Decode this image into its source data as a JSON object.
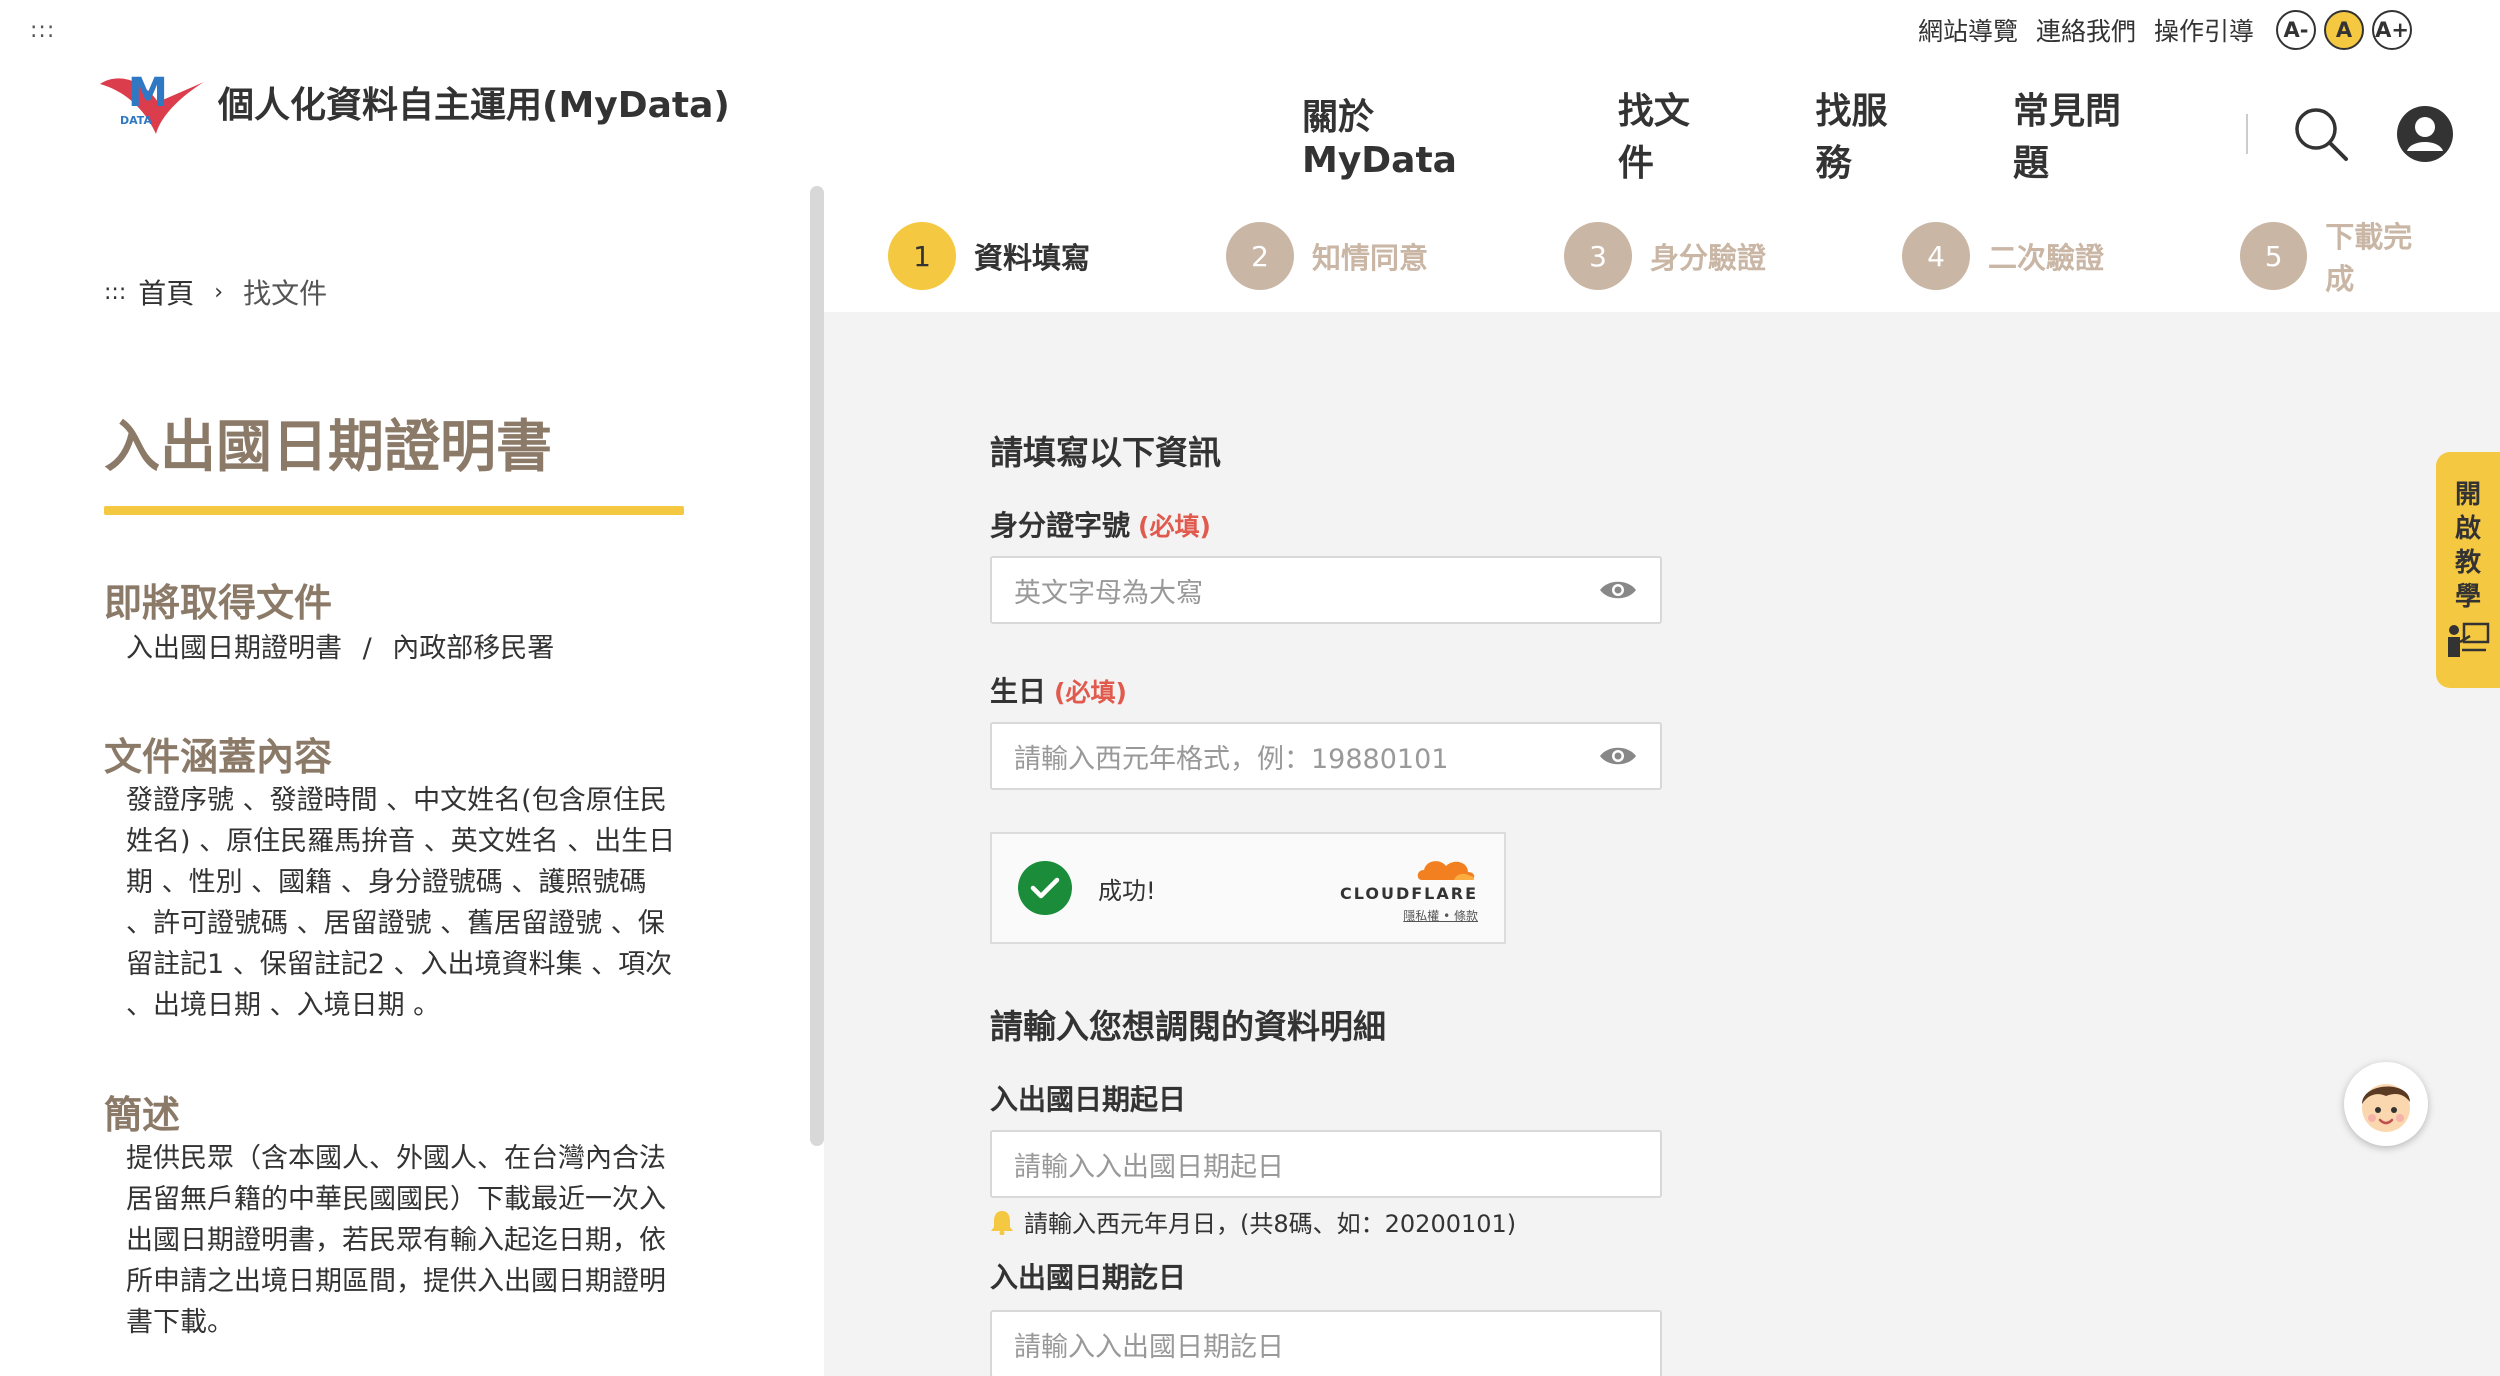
{
  "skip_link": ":::",
  "utility": {
    "sitemap": "網站導覽",
    "contact": "連絡我們",
    "guide": "操作引導",
    "font_small": "A-",
    "font_medium": "A",
    "font_large": "A+"
  },
  "logo": {
    "letter": "M",
    "sub": "DATA"
  },
  "brand": "個人化資料自主運用(MyData)",
  "nav": {
    "about": "關於MyData",
    "find_doc": "找文件",
    "find_service": "找服務",
    "faq": "常見問題",
    "search_icon": "search-icon",
    "user_icon": "user-icon"
  },
  "breadcrumb": {
    "skip": ":::",
    "home": "首頁",
    "current": "找文件"
  },
  "doc": {
    "title": "入出國日期證明書",
    "obtain_heading": "即將取得文件",
    "obtain_doc": "入出國日期證明書",
    "obtain_sep": "/",
    "obtain_agency": "內政部移民署",
    "coverage_heading": "文件涵蓋內容",
    "coverage_lines": [
      "發證序號 、發證時間 、中文姓名(包含原住民",
      "姓名) 、原住民羅馬拚音 、英文姓名 、出生日",
      "期 、性別 、國籍 、身分證號碼 、護照號碼",
      "、許可證號碼 、居留證號 、舊居留證號 、保",
      "留註記1 、保留註記2 、入出境資料集 、項次",
      "、出境日期 、入境日期 。"
    ],
    "summary_heading": "簡述",
    "summary_lines": [
      "提供民眾（含本國人、外國人、在台灣內合法",
      "居留無戶籍的中華民國國民）下載最近一次入",
      "出國日期證明書，若民眾有輸入起迄日期，依",
      "所申請之出境日期區間，提供入出國日期證明",
      "書下載。"
    ]
  },
  "steps": [
    {
      "num": "1",
      "label": "資料填寫",
      "active": true
    },
    {
      "num": "2",
      "label": "知情同意",
      "active": false
    },
    {
      "num": "3",
      "label": "身分驗證",
      "active": false
    },
    {
      "num": "4",
      "label": "二次驗證",
      "active": false
    },
    {
      "num": "5",
      "label": "下載完成",
      "active": false
    }
  ],
  "form": {
    "heading": "請填寫以下資訊",
    "id_label": "身分證字號",
    "id_required": "(必填)",
    "id_placeholder": "英文字母為大寫",
    "birth_label": "生日",
    "birth_required": "(必填)",
    "birth_placeholder": "請輸入西元年格式，例：19880101",
    "detail_heading": "請輸入您想調閱的資料明細",
    "start_label": "入出國日期起日",
    "start_placeholder": "請輸入入出國日期起日",
    "start_hint": "請輸入西元年月日，(共8碼、如：20200101)",
    "end_label": "入出國日期訖日",
    "end_placeholder": "請輸入入出國日期訖日"
  },
  "turnstile": {
    "status": "成功!",
    "brand": "CLOUDFLARE",
    "links": "隱私權 • 條款"
  },
  "tutorial": {
    "chars": [
      "開",
      "啟",
      "教",
      "學"
    ]
  },
  "colors": {
    "accent": "#f5c842",
    "heading_brown": "#8c7a68",
    "step_inactive": "#c9b6a5",
    "required_red": "#e05a4e",
    "panel_bg": "#f3f3f3",
    "success_green": "#1a8c3a"
  }
}
